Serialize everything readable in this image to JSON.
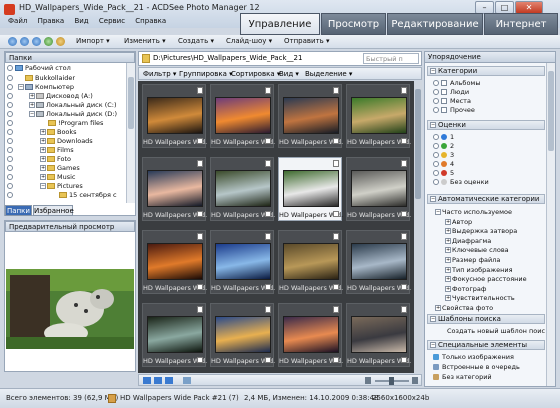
{
  "window": {
    "title": "HD_Wallpapers_Wide_Pack__21 - ACDSee Photo Manager 12",
    "controls": [
      "–",
      "□",
      "✕"
    ]
  },
  "menu": [
    "Файл",
    "Правка",
    "Вид",
    "Сервис",
    "Справка"
  ],
  "modes": [
    {
      "label": "Управление",
      "active": true
    },
    {
      "label": "Просмотр",
      "active": false
    },
    {
      "label": "Редактирование",
      "active": false
    },
    {
      "label": "Интернет",
      "active": false
    }
  ],
  "toolbar": {
    "import": "Импорт",
    "change": "Изменить",
    "create": "Создать",
    "slideshow": "Слайд-шоу",
    "send": "Отправить"
  },
  "folders_panel": {
    "title": "Папки",
    "tree": [
      {
        "label": "Рабочий стол",
        "level": 0
      },
      {
        "label": "Bukkollaider",
        "level": 1
      },
      {
        "label": "Компьютер",
        "level": 1
      },
      {
        "label": "Дисковод (A:)",
        "level": 2
      },
      {
        "label": "Локальный диск (C:)",
        "level": 2
      },
      {
        "label": "Локальный диск (D:)",
        "level": 2
      },
      {
        "label": "!Program files",
        "level": 3
      },
      {
        "label": "Books",
        "level": 3
      },
      {
        "label": "Downloads",
        "level": 3
      },
      {
        "label": "Films",
        "level": 3
      },
      {
        "label": "Foto",
        "level": 3
      },
      {
        "label": "Games",
        "level": 3
      },
      {
        "label": "Music",
        "level": 3
      },
      {
        "label": "Pictures",
        "level": 3
      },
      {
        "label": "15 сентября с",
        "level": 4
      }
    ],
    "tabs": [
      "Папки",
      "Избранное"
    ]
  },
  "preview_panel": {
    "title": "Предварительный просмотр"
  },
  "path": {
    "value": "D:\\Pictures\\HD_Wallpapers_Wide_Pack__21",
    "search_placeholder": "Быстрый п"
  },
  "filterbar": [
    "Фильтр",
    "Группировка",
    "Сортировка",
    "Вид",
    "Выделение"
  ],
  "thumbnails": [
    {
      "label": "HD Wallpapers Wid...",
      "selected": false,
      "colors": [
        "#3b2a1a",
        "#d08a3a",
        "#1a1410"
      ]
    },
    {
      "label": "HD Wallpapers Wid...",
      "selected": false,
      "colors": [
        "#6c3c7a",
        "#f08a30",
        "#2a1a30"
      ]
    },
    {
      "label": "HD Wallpapers Wid...",
      "selected": false,
      "colors": [
        "#2a3a52",
        "#c07440",
        "#151b25"
      ]
    },
    {
      "label": "HD Wallpapers Wid...",
      "selected": false,
      "colors": [
        "#3a7a2a",
        "#c7a96a",
        "#204018"
      ]
    },
    {
      "label": "HD Wallpapers Wid...",
      "selected": false,
      "colors": [
        "#283a58",
        "#e9b8a0",
        "#121826"
      ]
    },
    {
      "label": "HD Wallpapers Wid...",
      "selected": false,
      "colors": [
        "#3a4a2a",
        "#b6c6c8",
        "#1d2414"
      ]
    },
    {
      "label": "HD Wallpapers Wid...",
      "selected": true,
      "colors": [
        "#3f6b2f",
        "#e8e8e8",
        "#2a2a2a"
      ]
    },
    {
      "label": "HD Wallpapers Wid...",
      "selected": false,
      "colors": [
        "#5a5a58",
        "#d0d0c8",
        "#2c2c2a"
      ]
    },
    {
      "label": "HD Wallpapers Wid...",
      "selected": false,
      "colors": [
        "#4a1a10",
        "#e07a2a",
        "#1a0a06"
      ]
    },
    {
      "label": "HD Wallpapers Wid...",
      "selected": false,
      "colors": [
        "#1a3a8a",
        "#88b8e8",
        "#0a1a40"
      ]
    },
    {
      "label": "HD Wallpapers Wid...",
      "selected": false,
      "colors": [
        "#5a4a2a",
        "#b89858",
        "#2a2214"
      ]
    },
    {
      "label": "HD Wallpapers Wid...",
      "selected": false,
      "colors": [
        "#2a3a4a",
        "#a8b8c8",
        "#162028"
      ]
    },
    {
      "label": "HD Wallpapers Wid...",
      "selected": false,
      "colors": [
        "#1a2418",
        "#8aa8a0",
        "#0c140c"
      ]
    },
    {
      "label": "HD Wallpapers Wid...",
      "selected": false,
      "colors": [
        "#2a4a8a",
        "#e8b050",
        "#1a2a50"
      ]
    },
    {
      "label": "HD Wallpapers Wid...",
      "selected": false,
      "colors": [
        "#3a2a4a",
        "#e88a50",
        "#1a1024"
      ]
    },
    {
      "label": "HD Wallpapers Wid...",
      "selected": false,
      "colors": [
        "#7a6a5a",
        "#3a3a40",
        "#c8b8a8"
      ]
    }
  ],
  "right_panel": {
    "title": "Упорядочение",
    "categories": {
      "header": "Категории",
      "items": [
        "Альбомы",
        "Люди",
        "Места",
        "Прочее"
      ]
    },
    "ratings": {
      "header": "Оценки",
      "items": [
        {
          "label": "1",
          "color": "#2f7ad9"
        },
        {
          "label": "2",
          "color": "#3aa53a"
        },
        {
          "label": "3",
          "color": "#e6b42c"
        },
        {
          "label": "4",
          "color": "#e07a2a"
        },
        {
          "label": "5",
          "color": "#d03a2a"
        },
        {
          "label": "Без оценки",
          "color": "#cccccc"
        }
      ]
    },
    "auto_categories": {
      "header": "Автоматические категории",
      "items": [
        "Часто используемое",
        "Автор",
        "Выдержка затвора",
        "Диафрагма",
        "Ключевые слова",
        "Размер файла",
        "Тип изображения",
        "Фокусное расстояние",
        "Фотограф",
        "Чувствительность",
        "Свойства фото"
      ]
    },
    "search_templates": {
      "header": "Шаблоны поиска",
      "action": "Создать новый шаблон поис"
    },
    "special": {
      "header": "Специальные элементы",
      "items": [
        "Только изображения",
        "Встроенные в очередь",
        "Без категорий"
      ]
    }
  },
  "status": {
    "total": "Всего элементов: 39  (62,9 МБ)",
    "file": "HD Wallpapers Wide Pack #21 (7)",
    "info": "2,4 МБ, Изменен: 14.10.2009 0:38:48",
    "resolution": "2560x1600x24b"
  }
}
